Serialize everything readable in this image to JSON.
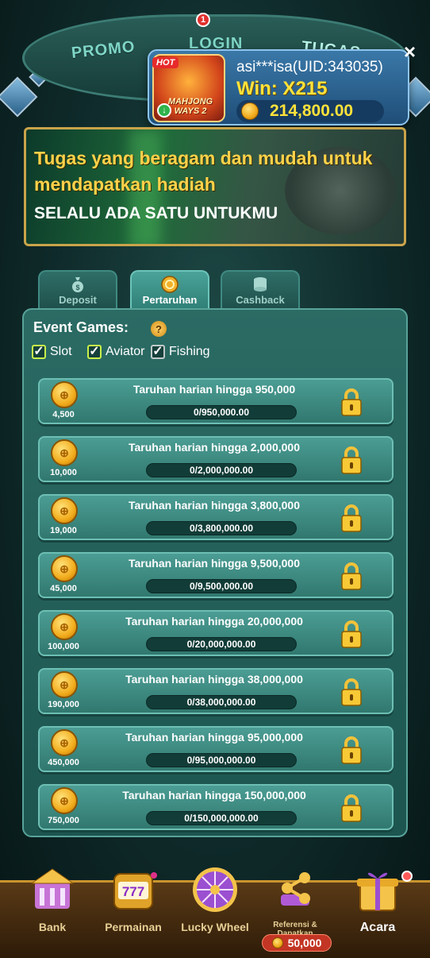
{
  "top_tabs": [
    "PROMO",
    "LOGIN",
    "TUGAS"
  ],
  "notification_count": "1",
  "win_popup": {
    "hot_label": "HOT",
    "game_title": "MAHJONG WAYS 2",
    "user": "asi***isa(UID:343035)",
    "multiplier": "Win: X215",
    "amount": "214,800.00",
    "close": "×"
  },
  "banner": {
    "line1": "Tugas yang beragam dan mudah untuk mendapatkan hadiah",
    "line2": "SELALU ADA SATU UNTUKMU"
  },
  "tabs": [
    {
      "label": "Deposit",
      "active": false
    },
    {
      "label": "Pertaruhan",
      "active": true
    },
    {
      "label": "Cashback",
      "active": false
    }
  ],
  "event": {
    "title": "Event Games:",
    "help": "?",
    "filters": [
      {
        "label": "Slot",
        "checked": true
      },
      {
        "label": "Aviator",
        "checked": true
      },
      {
        "label": "Fishing",
        "checked": true
      }
    ]
  },
  "tasks": [
    {
      "reward": "4,500",
      "title": "Taruhan harian hingga 950,000",
      "progress": "0/950,000.00",
      "fraction": 0
    },
    {
      "reward": "10,000",
      "title": "Taruhan harian hingga 2,000,000",
      "progress": "0/2,000,000.00",
      "fraction": 0
    },
    {
      "reward": "19,000",
      "title": "Taruhan harian hingga 3,800,000",
      "progress": "0/3,800,000.00",
      "fraction": 0
    },
    {
      "reward": "45,000",
      "title": "Taruhan harian hingga 9,500,000",
      "progress": "0/9,500,000.00",
      "fraction": 0
    },
    {
      "reward": "100,000",
      "title": "Taruhan harian hingga 20,000,000",
      "progress": "0/20,000,000.00",
      "fraction": 0
    },
    {
      "reward": "190,000",
      "title": "Taruhan harian hingga 38,000,000",
      "progress": "0/38,000,000.00",
      "fraction": 0
    },
    {
      "reward": "450,000",
      "title": "Taruhan harian hingga 95,000,000",
      "progress": "0/95,000,000.00",
      "fraction": 0
    },
    {
      "reward": "750,000",
      "title": "Taruhan harian hingga 150,000,000",
      "progress": "0/150,000,000.00",
      "fraction": 0
    }
  ],
  "bottom_nav": [
    {
      "label": "Bank",
      "icon": "bank-icon"
    },
    {
      "label": "Permainan",
      "icon": "slot-machine-icon"
    },
    {
      "label": "Lucky Wheel",
      "icon": "wheel-icon"
    },
    {
      "label": "Referensi & Dapatkan",
      "icon": "referral-icon"
    },
    {
      "label": "Acara",
      "icon": "gift-icon"
    }
  ],
  "referral_bonus": "50,000",
  "colors": {
    "accent_gold": "#ffe23a",
    "panel_teal": "#2b6b64",
    "progress_fill": "#6bd36b"
  }
}
